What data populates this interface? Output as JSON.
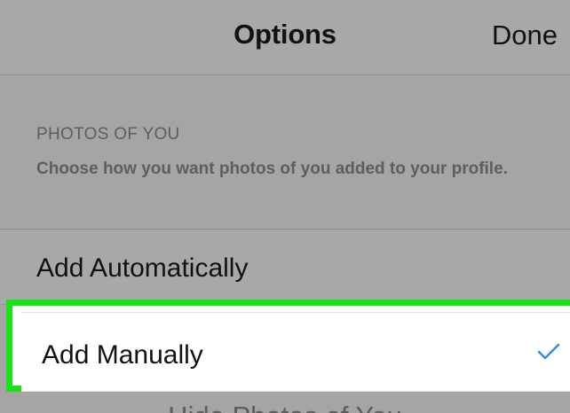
{
  "nav": {
    "title": "Options",
    "done_label": "Done"
  },
  "section": {
    "title": "PHOTOS OF YOU",
    "description": "Choose how you want photos of you added to your profile."
  },
  "options": [
    {
      "label": "Add Automatically",
      "selected": false
    },
    {
      "label": "Add Manually",
      "selected": true
    }
  ],
  "footer": {
    "partial_text": "Hide Photos of You"
  },
  "colors": {
    "highlight": "#18e414",
    "check": "#2f8ef4"
  },
  "icons": {
    "selected": "checkmark-icon"
  }
}
